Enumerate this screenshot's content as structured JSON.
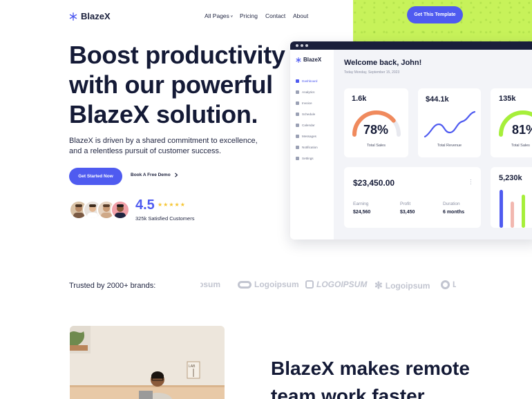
{
  "nav": {
    "logo_text": "BlazeX",
    "items": [
      "All Pages",
      "Pricing",
      "Contact",
      "About"
    ],
    "cta": "Get This Template"
  },
  "hero": {
    "title_lines": [
      "Boost productivity",
      "with our powerful",
      "BlazeX solution."
    ],
    "subtitle": "BlazeX is driven by a shared commitment to excellence, and a relentless pursuit of customer success.",
    "primary_button": "Get Started Now",
    "secondary_button": "Book A Free Demo",
    "rating": "4.5",
    "rating_caption": "325k Satisfied Customers"
  },
  "dashboard": {
    "logo_text": "BlazeX",
    "sidebar": [
      "Dashboard",
      "Analytics",
      "Invoice",
      "Schedule",
      "Calendar",
      "Messages",
      "Notification",
      "Settings"
    ],
    "welcome": "Welcome back, John!",
    "date": "Today Monday, September 15, 2023",
    "card1": {
      "value": "1.6k",
      "percent": "78%",
      "label": "Total Sales",
      "progress": 0.78
    },
    "card2": {
      "value": "$44.1k",
      "label": "Total Revenue"
    },
    "card3": {
      "value": "135k",
      "percent": "81%",
      "label": "Total Sales",
      "progress": 0.81
    },
    "balance": {
      "amount": "$23,450.00",
      "cols": [
        {
          "label": "Earning",
          "value": "$24,560"
        },
        {
          "label": "Profit",
          "value": "$3,450"
        },
        {
          "label": "Duration",
          "value": "6 months"
        }
      ]
    },
    "bars_card": {
      "value": "5,230k"
    }
  },
  "trusted": {
    "label": "Trusted by 2000+ brands:",
    "brands": [
      "psum",
      "Logoipsum",
      "LOGOIPSUM",
      "Logoipsum",
      "L"
    ]
  },
  "feature": {
    "title_lines": [
      "BlazeX makes remote",
      "team work faster."
    ]
  },
  "colors": {
    "accent": "#4f5bf0",
    "green": "#c7f25a",
    "orange": "#f08a5d",
    "pink": "#f2b8b0"
  }
}
